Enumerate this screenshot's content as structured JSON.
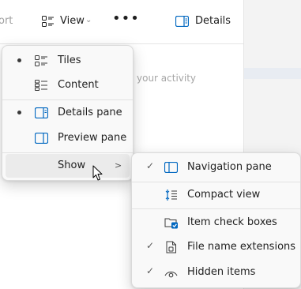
{
  "toolbar": {
    "sort_label": "ort",
    "view_label": "View",
    "more_label": "•••",
    "details_label": "Details"
  },
  "content": {
    "activity_hint": "your activity"
  },
  "view_menu": {
    "items": [
      {
        "label": "Tiles",
        "icon": "tiles-icon",
        "selected": true
      },
      {
        "label": "Content",
        "icon": "content-icon",
        "selected": false
      },
      {
        "label": "Details pane",
        "icon": "details-pane-icon",
        "selected": true
      },
      {
        "label": "Preview pane",
        "icon": "preview-pane-icon",
        "selected": false
      },
      {
        "label": "Show",
        "icon": "",
        "submenu": true
      }
    ]
  },
  "show_menu": {
    "items": [
      {
        "label": "Navigation pane",
        "icon": "navigation-pane-icon",
        "checked": true
      },
      {
        "label": "Compact view",
        "icon": "compact-view-icon",
        "checked": false
      },
      {
        "label": "Item check boxes",
        "icon": "item-check-boxes-icon",
        "checked": false
      },
      {
        "label": "File name extensions",
        "icon": "file-icon",
        "checked": true
      },
      {
        "label": "Hidden items",
        "icon": "eye-icon",
        "checked": true
      }
    ]
  },
  "colors": {
    "accent": "#0067c0",
    "menu_bg": "#f9f9f9",
    "hover_bg": "#ebebeb"
  }
}
